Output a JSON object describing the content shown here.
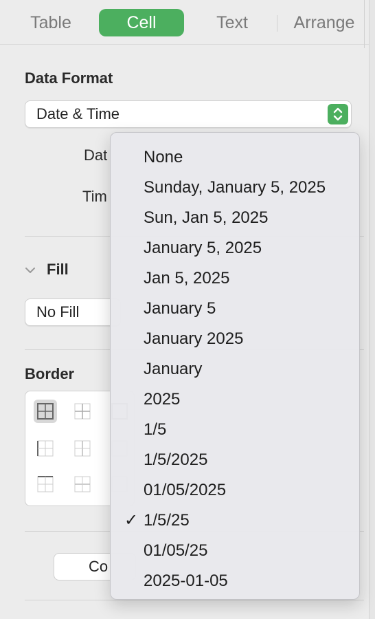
{
  "tabs": [
    {
      "label": "Table"
    },
    {
      "label": "Cell"
    },
    {
      "label": "Text"
    },
    {
      "label": "Arrange"
    }
  ],
  "data_format": {
    "title": "Data Format",
    "selected": "Date & Time",
    "date_label_partial": "Dat",
    "time_label_partial": "Tim"
  },
  "fill": {
    "title": "Fill",
    "selected": "No Fill"
  },
  "border": {
    "title": "Border"
  },
  "bottom_button": {
    "label_partial": "Co"
  },
  "menu": {
    "items": [
      "None",
      "Sunday, January 5, 2025",
      "Sun, Jan 5, 2025",
      "January 5, 2025",
      "Jan 5, 2025",
      "January 5",
      "January 2025",
      "January",
      "2025",
      "1/5",
      "1/5/2025",
      "01/05/2025",
      "1/5/25",
      "01/05/25",
      "2025-01-05"
    ],
    "checked_index": 12,
    "check_glyph": "✓"
  },
  "colors": {
    "accent": "#4caf5f",
    "panel": "#ececec"
  }
}
